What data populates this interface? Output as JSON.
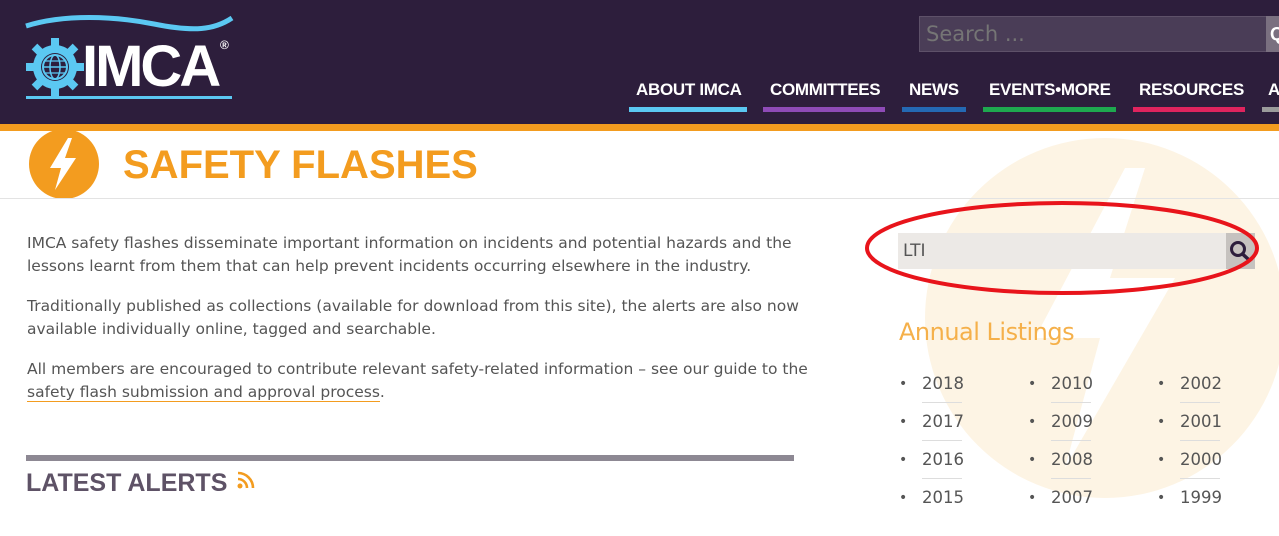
{
  "logo": {
    "text": "IMCA",
    "reg": "®"
  },
  "search_top": {
    "placeholder": "Search ..."
  },
  "nav": [
    {
      "label": "ABOUT IMCA",
      "color": "#5bc8f2"
    },
    {
      "label": "COMMITTEES",
      "color": "#8e4bb7"
    },
    {
      "label": "NEWS",
      "color": "#2469b3"
    },
    {
      "label": "EVENTS•MORE",
      "color": "#1ea84f"
    },
    {
      "label": "RESOURCES",
      "color": "#e0245e"
    },
    {
      "label": "A",
      "color": "#9b9b9b"
    }
  ],
  "page": {
    "title": "SAFETY FLASHES"
  },
  "body": {
    "p1": "IMCA safety flashes disseminate important information on incidents and potential hazards and the lessons learnt from them that can help prevent incidents occurring elsewhere in the industry.",
    "p2": "Traditionally published as collections (available for download from this site), the alerts are also now available individually online, tagged and searchable.",
    "p3_text": "All members are encouraged to contribute relevant safety-related information – see our guide to the ",
    "p3_link": "safety flash submission and approval process",
    "p3_end": "."
  },
  "alerts": {
    "title": "LATEST ALERTS"
  },
  "sidebar": {
    "search_value": "LTI",
    "annual_title": "Annual Listings",
    "years": [
      [
        "2018",
        "2017",
        "2016",
        "2015"
      ],
      [
        "2010",
        "2009",
        "2008",
        "2007"
      ],
      [
        "2002",
        "2001",
        "2000",
        "1999"
      ]
    ]
  },
  "colors": {
    "header_bg": "#2d1e3c",
    "accent": "#f39c1f",
    "annotation": "#e8141b"
  }
}
